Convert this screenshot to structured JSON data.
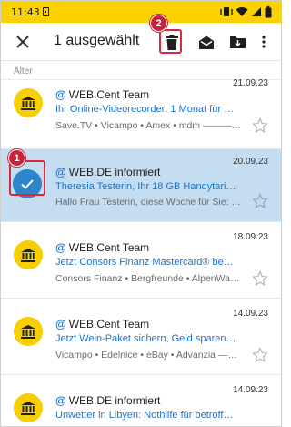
{
  "status_bar": {
    "time": "11:43",
    "color": "#fbd100"
  },
  "toolbar": {
    "selection_title": "1 ausgewählt",
    "icons": [
      "close-icon",
      "delete-icon",
      "mark-read-icon",
      "move-to-folder-icon",
      "more-options-icon"
    ]
  },
  "annotations": {
    "step_1": "1",
    "step_2": "2",
    "highlight_color": "#d6293e"
  },
  "section": {
    "label": "Älter"
  },
  "mails": [
    {
      "sender": "WEB.Cent Team",
      "date": "21.09.23",
      "subject": "Ihr Online-Videorecorder: 1 Monat für nur…",
      "preview": "Save.TV • Vicampo • Amex • mdm ————…",
      "selected": false
    },
    {
      "sender": "WEB.DE informiert",
      "date": "20.09.23",
      "subject": "Theresia Testerin, Ihr 18 GB Handytarif f…",
      "preview": "Hallo Frau Testerin, diese Woche für Sie: …",
      "selected": true
    },
    {
      "sender": "WEB.Cent Team",
      "date": "18.09.23",
      "subject": "Jetzt Consors Finanz Mastercard® bean…",
      "preview": "Consors Finanz • Bergfreunde • AlpenWa…",
      "selected": false
    },
    {
      "sender": "WEB.Cent Team",
      "date": "14.09.23",
      "subject": "Jetzt Wein-Paket sichern, Geld sparen un…",
      "preview": "Vicampo • Edelnice • eBay • Advanzia ——…",
      "selected": false
    },
    {
      "sender": "WEB.DE informiert",
      "date": "14.09.23",
      "subject": "Unwetter in Libyen: Nothilfe für betroffe…",
      "preview": "",
      "selected": false
    }
  ],
  "colors": {
    "accent": "#1d73c9",
    "avatar": "#f7ce00",
    "selected_row": "#c5ddf0",
    "check_avatar": "#2d86c9"
  }
}
